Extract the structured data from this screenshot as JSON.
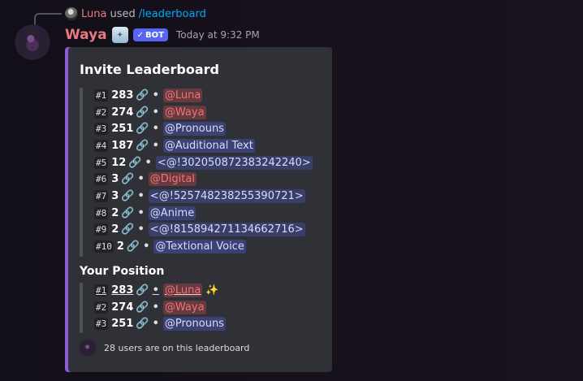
{
  "reply": {
    "user": "Luna",
    "used": "used",
    "command": "/leaderboard"
  },
  "message": {
    "author": "Waya",
    "bot_badge": "BOT",
    "timestamp": "Today at 9:32 PM"
  },
  "embed": {
    "title": "Invite Leaderboard",
    "accent_color": "#8f5ad5",
    "leaderboard": [
      {
        "rank": "#1",
        "count": "283",
        "link_icon": "🔗",
        "dot": "•",
        "mention": "@Luna",
        "mention_color": "red"
      },
      {
        "rank": "#2",
        "count": "274",
        "link_icon": "🔗",
        "dot": "•",
        "mention": "@Waya",
        "mention_color": "red"
      },
      {
        "rank": "#3",
        "count": "251",
        "link_icon": "🔗",
        "dot": "•",
        "mention": "@Pronouns",
        "mention_color": "blue"
      },
      {
        "rank": "#4",
        "count": "187",
        "link_icon": "🔗",
        "dot": "•",
        "mention": "@Auditional Text",
        "mention_color": "blue"
      },
      {
        "rank": "#5",
        "count": "12",
        "link_icon": "🔗",
        "dot": "•",
        "mention": "<@!302050872383242240>",
        "mention_color": "gray"
      },
      {
        "rank": "#6",
        "count": "3",
        "link_icon": "🔗",
        "dot": "•",
        "mention": "@Digital",
        "mention_color": "red"
      },
      {
        "rank": "#7",
        "count": "3",
        "link_icon": "🔗",
        "dot": "•",
        "mention": "<@!525748238255390721>",
        "mention_color": "gray"
      },
      {
        "rank": "#8",
        "count": "2",
        "link_icon": "🔗",
        "dot": "•",
        "mention": "@Anime",
        "mention_color": "blue"
      },
      {
        "rank": "#9",
        "count": "2",
        "link_icon": "🔗",
        "dot": "•",
        "mention": "<@!815894271134662716>",
        "mention_color": "gray"
      },
      {
        "rank": "#10",
        "count": "2",
        "link_icon": "🔗",
        "dot": "•",
        "mention": "@Textional Voice",
        "mention_color": "blue"
      }
    ],
    "position_title": "Your Position",
    "position_rows": [
      {
        "rank": "#1",
        "count": "283",
        "link_icon": "🔗",
        "dot": "•",
        "mention": "@Luna",
        "mention_color": "red",
        "extra": "✨"
      },
      {
        "rank": "#2",
        "count": "274",
        "link_icon": "🔗",
        "dot": "•",
        "mention": "@Waya",
        "mention_color": "red"
      },
      {
        "rank": "#3",
        "count": "251",
        "link_icon": "🔗",
        "dot": "•",
        "mention": "@Pronouns",
        "mention_color": "blue"
      }
    ],
    "footer": "28 users are on this leaderboard"
  }
}
